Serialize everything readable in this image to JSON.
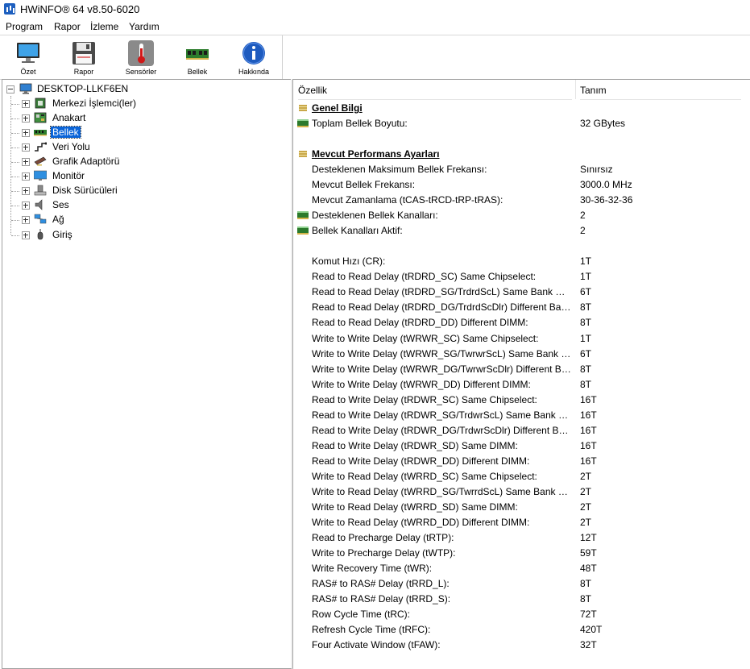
{
  "window": {
    "title": "HWiNFO® 64 v8.50-6020"
  },
  "menu": [
    "Program",
    "Rapor",
    "İzleme",
    "Yardım"
  ],
  "toolbar": [
    {
      "label": "Özet",
      "icon": "monitor-icon"
    },
    {
      "label": "Rapor",
      "icon": "floppy-icon"
    },
    {
      "label": "Sensörler",
      "icon": "thermometer-icon"
    },
    {
      "label": "Bellek",
      "icon": "ram-icon"
    },
    {
      "label": "Hakkında",
      "icon": "info-icon"
    }
  ],
  "tree": {
    "root": "DESKTOP-LLKF6EN",
    "items": [
      {
        "label": "Merkezi İşlemci(ler)",
        "icon": "cpu-icon"
      },
      {
        "label": "Anakart",
        "icon": "motherboard-icon"
      },
      {
        "label": "Bellek",
        "icon": "ram-icon",
        "selected": true
      },
      {
        "label": "Veri Yolu",
        "icon": "bus-icon"
      },
      {
        "label": "Grafik Adaptörü",
        "icon": "gpu-icon"
      },
      {
        "label": "Monitör",
        "icon": "monitor-icon"
      },
      {
        "label": "Disk Sürücüleri",
        "icon": "disk-icon"
      },
      {
        "label": "Ses",
        "icon": "speaker-icon"
      },
      {
        "label": "Ağ",
        "icon": "network-icon"
      },
      {
        "label": "Giriş",
        "icon": "mouse-icon"
      }
    ]
  },
  "details": {
    "columns": {
      "property": "Özellik",
      "value": "Tanım"
    },
    "rows": [
      {
        "type": "section",
        "label": "Genel Bilgi"
      },
      {
        "type": "item",
        "label": "Toplam Bellek Boyutu:",
        "value": "32 GBytes",
        "icon": "ram-icon"
      },
      {
        "type": "blank"
      },
      {
        "type": "section",
        "label": "Mevcut Performans Ayarları"
      },
      {
        "type": "item",
        "label": "Desteklenen Maksimum Bellek Frekansı:",
        "value": "Sınırsız"
      },
      {
        "type": "item",
        "label": "Mevcut Bellek Frekansı:",
        "value": "3000.0 MHz"
      },
      {
        "type": "item",
        "label": "Mevcut Zamanlama (tCAS-tRCD-tRP-tRAS):",
        "value": "30-36-32-36"
      },
      {
        "type": "item",
        "label": "Desteklenen Bellek Kanalları:",
        "value": "2",
        "icon": "ram-icon"
      },
      {
        "type": "item",
        "label": "Bellek Kanalları Aktif:",
        "value": "2",
        "icon": "ram-icon"
      },
      {
        "type": "blank"
      },
      {
        "type": "item",
        "label": "Komut Hızı (CR):",
        "value": "1T"
      },
      {
        "type": "item",
        "label": "Read to Read Delay (tRDRD_SC) Same Chipselect:",
        "value": "1T"
      },
      {
        "type": "item",
        "label": "Read to Read Delay (tRDRD_SG/TrdrdScL) Same Bank Group:",
        "value": "6T"
      },
      {
        "type": "item",
        "label": "Read to Read Delay (tRDRD_DG/TrdrdScDlr) Different Bank Group:",
        "value": "8T"
      },
      {
        "type": "item",
        "label": "Read to Read Delay (tRDRD_DD) Different DIMM:",
        "value": "8T"
      },
      {
        "type": "item",
        "label": "Write to Write Delay (tWRWR_SC) Same Chipselect:",
        "value": "1T"
      },
      {
        "type": "item",
        "label": "Write to Write Delay (tWRWR_SG/TwrwrScL) Same Bank Group:",
        "value": "6T"
      },
      {
        "type": "item",
        "label": "Write to Write Delay (tWRWR_DG/TwrwrScDlr) Different Bank Group:",
        "value": "8T"
      },
      {
        "type": "item",
        "label": "Write to Write Delay (tWRWR_DD) Different DIMM:",
        "value": "8T"
      },
      {
        "type": "item",
        "label": "Read to Write Delay (tRDWR_SC) Same Chipselect:",
        "value": "16T"
      },
      {
        "type": "item",
        "label": "Read to Write Delay (tRDWR_SG/TrdwrScL) Same Bank Group:",
        "value": "16T"
      },
      {
        "type": "item",
        "label": "Read to Write Delay (tRDWR_DG/TrdwrScDlr) Different Bank Group:",
        "value": "16T"
      },
      {
        "type": "item",
        "label": "Read to Write Delay (tRDWR_SD) Same DIMM:",
        "value": "16T"
      },
      {
        "type": "item",
        "label": "Read to Write Delay (tRDWR_DD) Different DIMM:",
        "value": "16T"
      },
      {
        "type": "item",
        "label": "Write to Read Delay (tWRRD_SC) Same Chipselect:",
        "value": "2T"
      },
      {
        "type": "item",
        "label": "Write to Read Delay (tWRRD_SG/TwrrdScL) Same Bank Group:",
        "value": "2T"
      },
      {
        "type": "item",
        "label": "Write to Read Delay (tWRRD_SD) Same DIMM:",
        "value": "2T"
      },
      {
        "type": "item",
        "label": "Write to Read Delay (tWRRD_DD) Different DIMM:",
        "value": "2T"
      },
      {
        "type": "item",
        "label": "Read to Precharge Delay (tRTP):",
        "value": "12T"
      },
      {
        "type": "item",
        "label": "Write to Precharge Delay (tWTP):",
        "value": "59T"
      },
      {
        "type": "item",
        "label": "Write Recovery Time (tWR):",
        "value": "48T"
      },
      {
        "type": "item",
        "label": "RAS# to RAS# Delay (tRRD_L):",
        "value": "8T"
      },
      {
        "type": "item",
        "label": "RAS# to RAS# Delay (tRRD_S):",
        "value": "8T"
      },
      {
        "type": "item",
        "label": "Row Cycle Time (tRC):",
        "value": "72T"
      },
      {
        "type": "item",
        "label": "Refresh Cycle Time (tRFC):",
        "value": "420T"
      },
      {
        "type": "item",
        "label": "Four Activate Window (tFAW):",
        "value": "32T"
      }
    ]
  }
}
